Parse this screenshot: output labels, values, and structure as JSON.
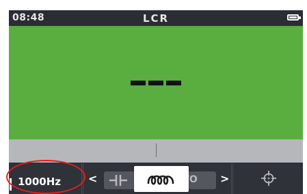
{
  "statusbar": {
    "time": "08:48",
    "title": "LCR",
    "battery_icon": "battery-full-icon"
  },
  "display": {
    "reading": "---",
    "background_color": "#5aad3f"
  },
  "softkeys": {
    "frequency": {
      "label": "1000Hz"
    },
    "mode": {
      "prev_icon": "chevron-left-icon",
      "next_icon": "chevron-right-icon",
      "options": [
        {
          "icon": "capacitor-icon"
        },
        {
          "icon": "inductor-icon",
          "selected": true
        },
        {
          "label": "UTO"
        }
      ]
    },
    "cursor": {
      "icon": "crosshair-icon"
    }
  },
  "annotation": {
    "color": "#e0201c"
  }
}
